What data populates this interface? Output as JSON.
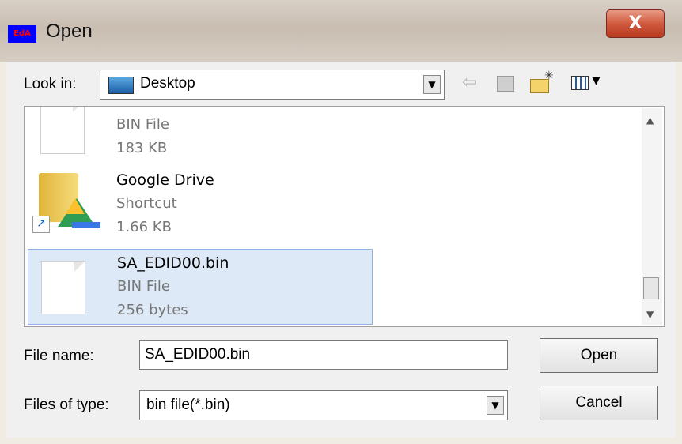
{
  "window": {
    "title": "Open",
    "app_icon_text": "EdA",
    "close_label": "X"
  },
  "toolbar": {
    "look_in_label": "Look in:",
    "look_in_value": "Desktop"
  },
  "files": [
    {
      "name": "",
      "type": "BIN File",
      "size": "183 KB"
    },
    {
      "name": "Google Drive",
      "type": "Shortcut",
      "size": "1.66 KB"
    },
    {
      "name": "SA_EDID00.bin",
      "type": "BIN File",
      "size": "256 bytes",
      "selected": true
    }
  ],
  "form": {
    "file_name_label": "File name:",
    "file_name_value": "SA_EDID00.bin",
    "file_type_label": "Files of type:",
    "file_type_value": "bin file(*.bin)"
  },
  "buttons": {
    "open": "Open",
    "cancel": "Cancel"
  }
}
